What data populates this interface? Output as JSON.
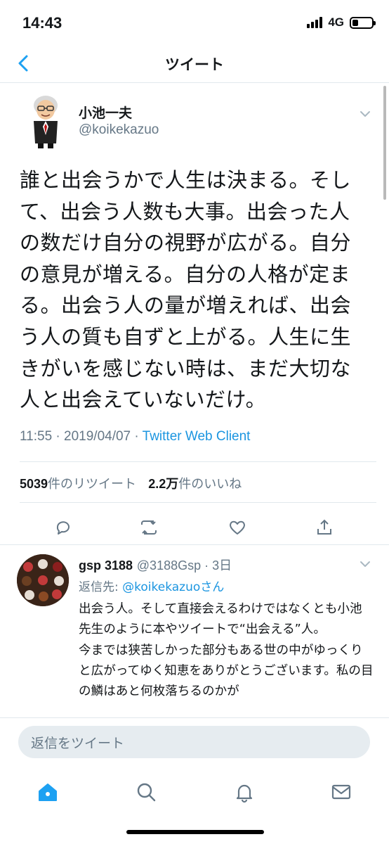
{
  "status_bar": {
    "time": "14:43",
    "network": "4G"
  },
  "nav": {
    "title": "ツイート"
  },
  "tweet": {
    "author_name": "小池一夫",
    "author_handle": "@koikekazuo",
    "text": "誰と出会うかで人生は決まる。そして、出会う人数も大事。出会った人の数だけ自分の視野が広がる。自分の意見が増える。自分の人格が定まる。出会う人の量が増えれば、出会う人の質も自ずと上がる。人生に生きがいを感じない時は、まだ大切な人と出会えていないだけ。",
    "timestamp": "11:55 · 2019/04/07 · ",
    "client": "Twitter Web Client",
    "retweet_count": "5039",
    "retweet_label": "件のリツイート",
    "like_count": "2.2万",
    "like_label": "件のいいね"
  },
  "reply": {
    "name": "gsp 3188",
    "handle": "@3188Gsp",
    "time": "3日",
    "reply_to_label": "返信先: ",
    "reply_to_handle": "@koikekazuoさん",
    "text": "出会う人。そして直接会えるわけではなくとも小池先生のように本やツイートで“出会える”人。\n今までは狭苦しかった部分もある世の中がゆっくりと広がってゆく知恵をありがとうございます。私の目の鱗はあと何枚落ちるのかが"
  },
  "composer": {
    "placeholder": "返信をツイート"
  },
  "icons": {
    "back": "chevron-left-icon",
    "caret": "chevron-down-icon",
    "reply": "reply-icon",
    "retweet": "retweet-icon",
    "like": "heart-icon",
    "share": "share-icon",
    "home": "home-icon",
    "search": "search-icon",
    "notifications": "bell-icon",
    "messages": "mail-icon"
  },
  "colors": {
    "accent": "#1da1f2",
    "link": "#1b95e0",
    "muted": "#657786",
    "icon": "#657786"
  }
}
